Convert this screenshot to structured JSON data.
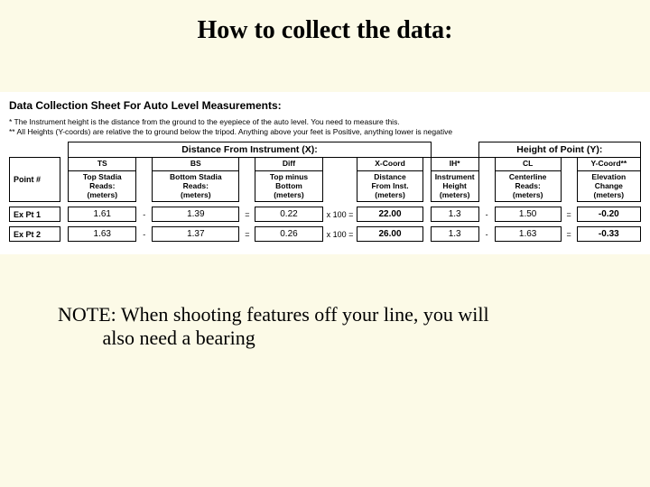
{
  "title": "How to collect the data:",
  "sheet_title": "Data Collection Sheet For Auto Level Measurements:",
  "footnotes": [
    "* The Instrument height is the distance from the ground to the eyepiece of the auto level.  You need to measure this.",
    "** All Heights (Y-coords) are relative the to ground below the tripod.  Anything above your feet is Positive, anything lower is negative"
  ],
  "group_heads": {
    "distance": "Distance From Instrument (X):",
    "height": "Height of Point (Y):"
  },
  "columns": {
    "point": "Point #",
    "ts_head": "TS",
    "ts_sub": "Top Stadia\nReads:\n(meters)",
    "bs_head": "BS",
    "bs_sub": "Bottom Stadia\nReads:\n(meters)",
    "diff_head": "Diff",
    "diff_sub": "Top minus\nBottom\n(meters)",
    "xcoord_head": "X-Coord",
    "xcoord_sub": "Distance\nFrom Inst.\n(meters)",
    "ih_head": "IH*",
    "ih_sub": "Instrument\nHeight\n(meters)",
    "cl_head": "CL",
    "cl_sub": "Centerline\nReads:\n(meters)",
    "ycoord_head": "Y-Coord**",
    "ycoord_sub": "Elevation\nChange\n(meters)"
  },
  "ops": {
    "minus": "-",
    "equals": "=",
    "x100eq": "x 100   ="
  },
  "rows": [
    {
      "label": "Ex Pt 1",
      "ts": "1.61",
      "bs": "1.39",
      "diff": "0.22",
      "x": "22.00",
      "ih": "1.3",
      "cl": "1.50",
      "y": "-0.20"
    },
    {
      "label": "Ex Pt 2",
      "ts": "1.63",
      "bs": "1.37",
      "diff": "0.26",
      "x": "26.00",
      "ih": "1.3",
      "cl": "1.63",
      "y": "-0.33"
    }
  ],
  "note_line1": "NOTE: When shooting features off your line, you will",
  "note_line2": "also need a bearing"
}
